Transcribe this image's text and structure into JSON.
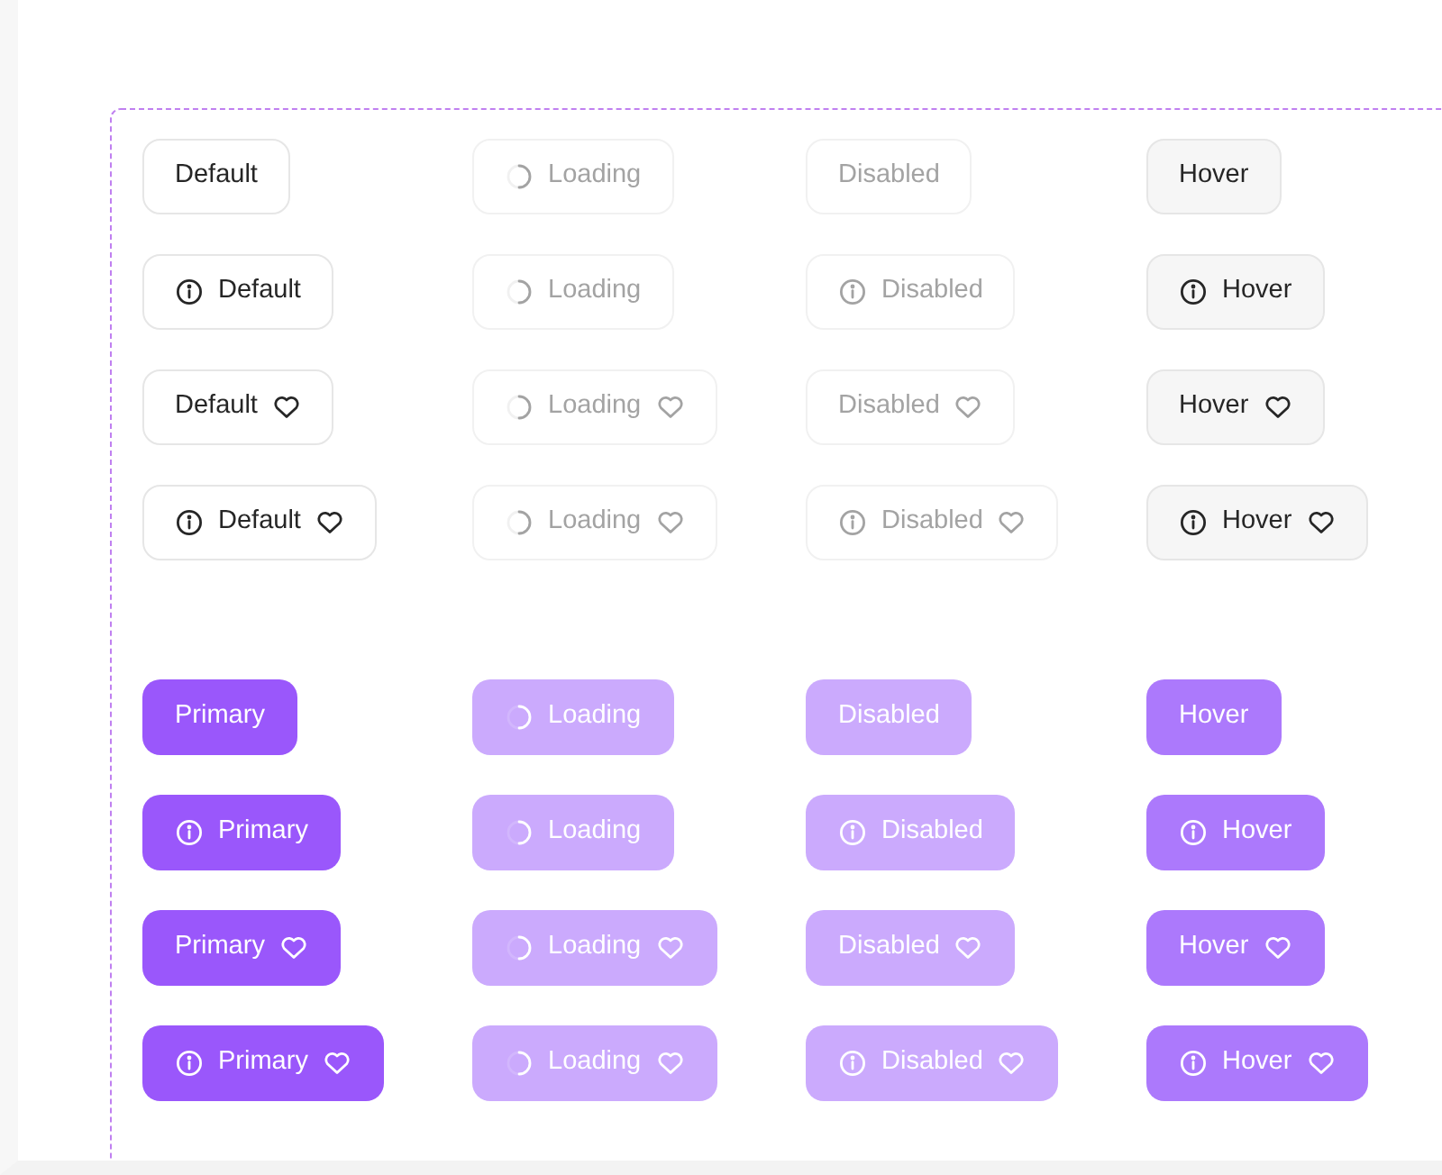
{
  "groups": [
    {
      "kind": "default",
      "rows": [
        [
          {
            "kind": "default",
            "label": "Default",
            "icon_start": false,
            "icon_end": false
          },
          {
            "kind": "loading",
            "label": "Loading",
            "icon_start": false,
            "icon_end": false
          },
          {
            "kind": "disabled",
            "label": "Disabled",
            "icon_start": false,
            "icon_end": false
          },
          {
            "kind": "hover",
            "label": "Hover",
            "icon_start": false,
            "icon_end": false
          }
        ],
        [
          {
            "kind": "default",
            "label": "Default",
            "icon_start": true,
            "icon_end": false
          },
          {
            "kind": "loading",
            "label": "Loading",
            "icon_start": false,
            "icon_end": false
          },
          {
            "kind": "disabled",
            "label": "Disabled",
            "icon_start": true,
            "icon_end": false
          },
          {
            "kind": "hover",
            "label": "Hover",
            "icon_start": true,
            "icon_end": false
          }
        ],
        [
          {
            "kind": "default",
            "label": "Default",
            "icon_start": false,
            "icon_end": true
          },
          {
            "kind": "loading",
            "label": "Loading",
            "icon_start": false,
            "icon_end": true
          },
          {
            "kind": "disabled",
            "label": "Disabled",
            "icon_start": false,
            "icon_end": true
          },
          {
            "kind": "hover",
            "label": "Hover",
            "icon_start": false,
            "icon_end": true
          }
        ],
        [
          {
            "kind": "default",
            "label": "Default",
            "icon_start": true,
            "icon_end": true
          },
          {
            "kind": "loading",
            "label": "Loading",
            "icon_start": false,
            "icon_end": true
          },
          {
            "kind": "disabled",
            "label": "Disabled",
            "icon_start": true,
            "icon_end": true
          },
          {
            "kind": "hover",
            "label": "Hover",
            "icon_start": true,
            "icon_end": true
          }
        ]
      ]
    },
    {
      "kind": "primary",
      "rows": [
        [
          {
            "kind": "default",
            "label": "Primary",
            "icon_start": false,
            "icon_end": false
          },
          {
            "kind": "loading",
            "label": "Loading",
            "icon_start": false,
            "icon_end": false
          },
          {
            "kind": "disabled",
            "label": "Disabled",
            "icon_start": false,
            "icon_end": false
          },
          {
            "kind": "hover",
            "label": "Hover",
            "icon_start": false,
            "icon_end": false
          }
        ],
        [
          {
            "kind": "default",
            "label": "Primary",
            "icon_start": true,
            "icon_end": false
          },
          {
            "kind": "loading",
            "label": "Loading",
            "icon_start": false,
            "icon_end": false
          },
          {
            "kind": "disabled",
            "label": "Disabled",
            "icon_start": true,
            "icon_end": false
          },
          {
            "kind": "hover",
            "label": "Hover",
            "icon_start": true,
            "icon_end": false
          }
        ],
        [
          {
            "kind": "default",
            "label": "Primary",
            "icon_start": false,
            "icon_end": true
          },
          {
            "kind": "loading",
            "label": "Loading",
            "icon_start": false,
            "icon_end": true
          },
          {
            "kind": "disabled",
            "label": "Disabled",
            "icon_start": false,
            "icon_end": true
          },
          {
            "kind": "hover",
            "label": "Hover",
            "icon_start": false,
            "icon_end": true
          }
        ],
        [
          {
            "kind": "default",
            "label": "Primary",
            "icon_start": true,
            "icon_end": true
          },
          {
            "kind": "loading",
            "label": "Loading",
            "icon_start": false,
            "icon_end": true
          },
          {
            "kind": "disabled",
            "label": "Disabled",
            "icon_start": true,
            "icon_end": true
          },
          {
            "kind": "hover",
            "label": "Hover",
            "icon_start": true,
            "icon_end": true
          }
        ]
      ]
    }
  ]
}
